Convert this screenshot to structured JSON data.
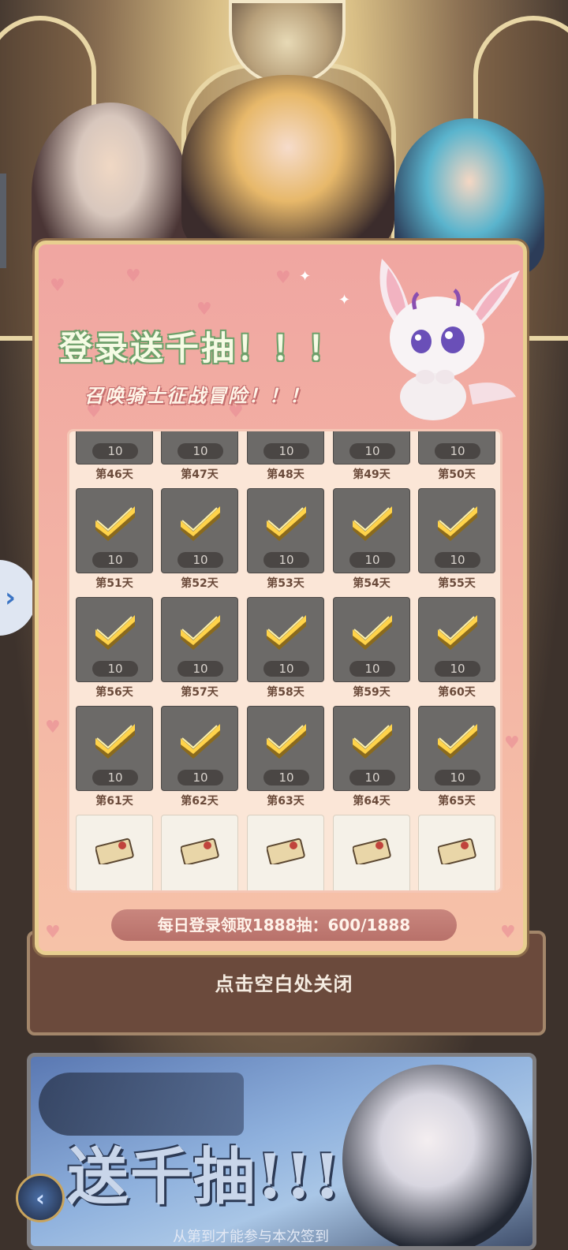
{
  "popup": {
    "title": "登录送千抽！！！",
    "subtitle": "召唤骑士征战冒险！！！",
    "progress_text": "每日登录领取1888抽：600/1888"
  },
  "reward_count": "10",
  "top_partial_row": [
    {
      "count": "10"
    },
    {
      "count": "10"
    },
    {
      "count": "10"
    },
    {
      "count": "10"
    },
    {
      "count": "10"
    }
  ],
  "rows": [
    {
      "label_day": [
        "第46天",
        "第47天",
        "第48天",
        "第49天",
        "第50天"
      ],
      "claimed": true
    },
    {
      "label_day": [
        "第51天",
        "第52天",
        "第53天",
        "第54天",
        "第55天"
      ],
      "claimed": true
    },
    {
      "label_day": [
        "第56天",
        "第57天",
        "第58天",
        "第59天",
        "第60天"
      ],
      "claimed": true
    },
    {
      "label_day": [
        "第61天",
        "第62天",
        "第63天",
        "第64天",
        "第65天"
      ],
      "claimed": false
    }
  ],
  "close_hint": "点击空白处关闭",
  "banner": {
    "title": "送千抽!!!",
    "subtitle": "从第到才能参与本次签到"
  },
  "colors": {
    "popup_bg": "#f0a6a1",
    "claimed_cell": "#6c6a68",
    "unclaimed_cell": "#f5f1e8",
    "progress_bar": "#c9867e",
    "frame_gold": "#e8cf8f"
  },
  "icons": {
    "claimed": "check-icon",
    "unclaimed": "summon-ticket-icon",
    "side_tab": "chevron-right-icon",
    "back": "chevron-left-icon"
  }
}
